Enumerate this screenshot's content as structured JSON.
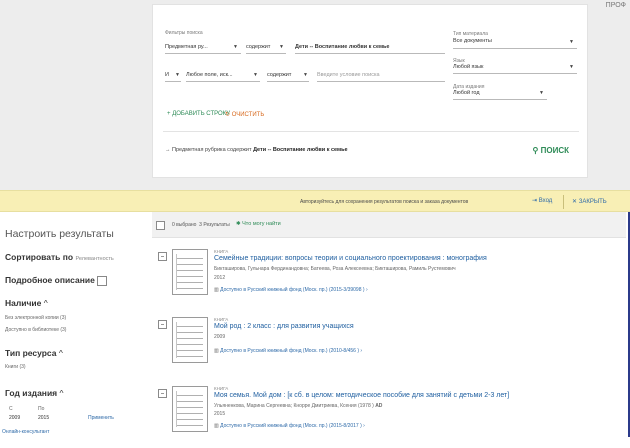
{
  "top_right_text": "ПРОФ",
  "search": {
    "filters_label": "Фильтры поиска",
    "row1": {
      "field": "Предметная ру...",
      "op": "содержит",
      "value": "Дети -- Воспитание любви к семье"
    },
    "row2": {
      "bool": "И",
      "field": "Любое поле, иск...",
      "op": "содержит",
      "placeholder": "Введите условие поиска"
    },
    "add_row": "ДОБАВИТЬ СТРОКУ",
    "clear": "ОЧИСТИТЬ",
    "doctype_label": "Тип материала",
    "doctype_value": "Все документы",
    "lang_label": "Язык",
    "lang_value": "Любой язык",
    "date_label": "Дата издания",
    "date_value": "Любой год",
    "query_prefix": "Предметная рубрика содержит",
    "query_value": "Дети -- Воспитание любви к семье",
    "search_button": "ПОИСК"
  },
  "banner": {
    "text": "Авторизуйтесь для сохранения результатов поиска и заказа документов",
    "login": "Вход",
    "close": "ЗАКРЫТЬ"
  },
  "sidebar": {
    "title": "Настроить результаты",
    "sort_label": "Сортировать по",
    "sort_value": "Релевантность",
    "detail_label": "Подробное описание",
    "availability_label": "Наличие",
    "availability_items": [
      "Без электронной копии (3)",
      "Доступно в библиотеке (3)"
    ],
    "restype_label": "Тип ресурса",
    "restype_items": [
      "Книги (3)"
    ],
    "year_label": "Год издания",
    "year_from_label": "С",
    "year_to_label": "По",
    "year_from": "2009",
    "year_to": "2015",
    "apply": "Применить",
    "online_help": "Онлайн-консультант"
  },
  "results": {
    "selected": "0 выбрано",
    "count": "3 Результаты",
    "online_link": "Что могу найти",
    "items": [
      {
        "type": "КНИГА",
        "title": "Семейные традиции: вопросы теории и социального проектирования : монография",
        "authors": "Бикташирова, Гульнара Фердинандовна; Батеева, Роза Алексеевна; Бикташирова, Рамиль Рустемович",
        "year": "2012",
        "availability": "Доступно в Русский книжный фонд (Моск. пр.)   (2015-3/39098 )"
      },
      {
        "type": "КНИГА",
        "title": "Мой род : 2 класс : для развития учащихся",
        "authors": "",
        "year": "2009",
        "availability": "Доступно в Русский книжный фонд (Моск. пр.)   (2010-8/456 )"
      },
      {
        "type": "КНИГА",
        "title": "Моя семья. Мой дом : [к сб. в целом: методическое пособие для занятий с детьми 2-3 лет]",
        "authors": "Ульяненкова, Марина Сергеевна; Кнорре Дмитриева, Ксения (1978 )",
        "year": "2015",
        "availability": "Доступно в Русский книжный фонд (Моск. пр.)   (2015-8/2017 )"
      }
    ]
  }
}
